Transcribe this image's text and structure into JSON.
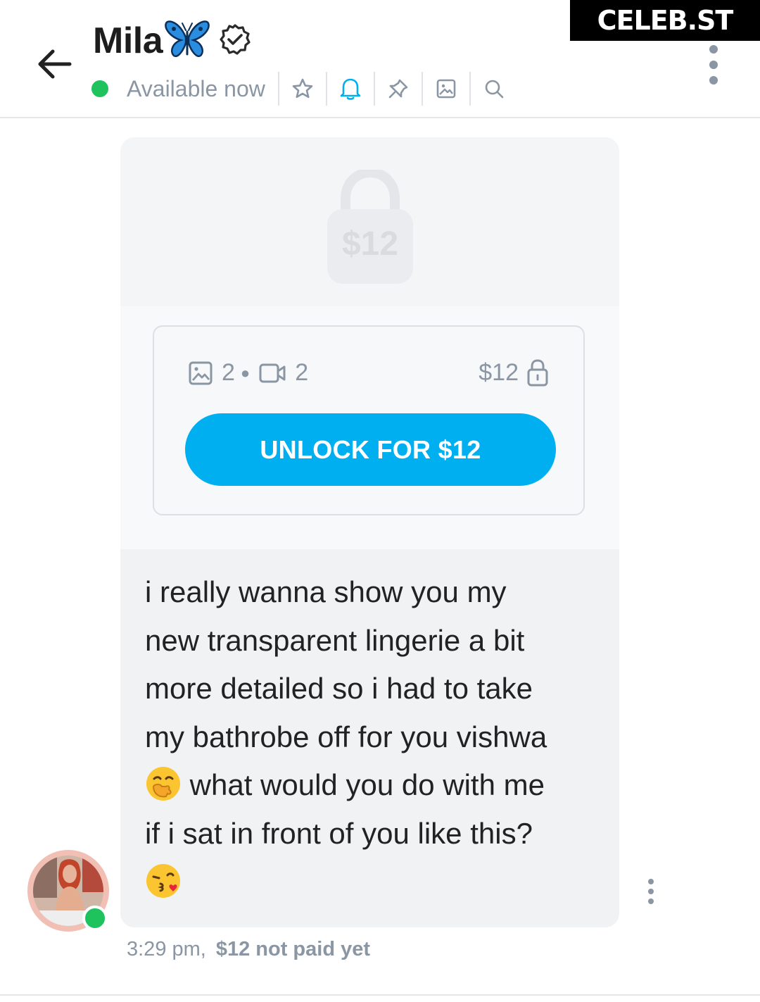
{
  "watermark": "CELEB.ST",
  "header": {
    "name": "Mila",
    "status": "Available now",
    "toolbar_icons": [
      "star-icon",
      "bell-icon",
      "pin-icon",
      "image-icon",
      "search-icon"
    ],
    "accent_color": "#00aff0",
    "online_color": "#1fc35e"
  },
  "message": {
    "lock_price": "$12",
    "media": {
      "images": "2",
      "videos": "2"
    },
    "price": "$12",
    "unlock_label": "UNLOCK FOR $12",
    "text_lines": [
      "i really wanna show you my",
      "new transparent lingerie a bit",
      "more detailed so i had to take",
      "my bathrobe off for you vishwa",
      "what would you do with me",
      "if i sat in front of you like this?"
    ],
    "time": "3:29 pm,",
    "payment_status": "$12 not paid yet"
  }
}
